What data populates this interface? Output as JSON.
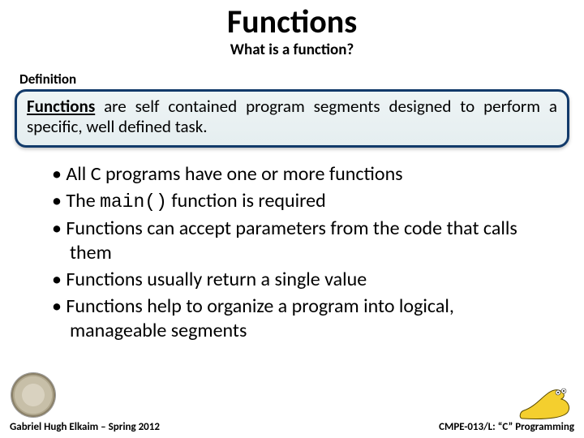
{
  "title": "Functions",
  "subtitle": "What is a function?",
  "section_label": "Definition",
  "definition": {
    "term": "Functions",
    "rest": " are self contained program segments designed to perform a specific, well defined task."
  },
  "bullets": [
    {
      "text": "All C programs have one or more functions"
    },
    {
      "pre": "The ",
      "code": "main()",
      "post": " function is required"
    },
    {
      "text": "Functions can accept parameters from the code that calls them"
    },
    {
      "text": "Functions usually return a single value"
    },
    {
      "text": "Functions help to organize a program into logical, manageable segments"
    }
  ],
  "footer": {
    "left": "Gabriel Hugh Elkaim – Spring 2012",
    "right": "CMPE-013/L: “C” Programming"
  },
  "icons": {
    "seal": "university-seal-icon",
    "mascot": "banana-slug-icon"
  }
}
